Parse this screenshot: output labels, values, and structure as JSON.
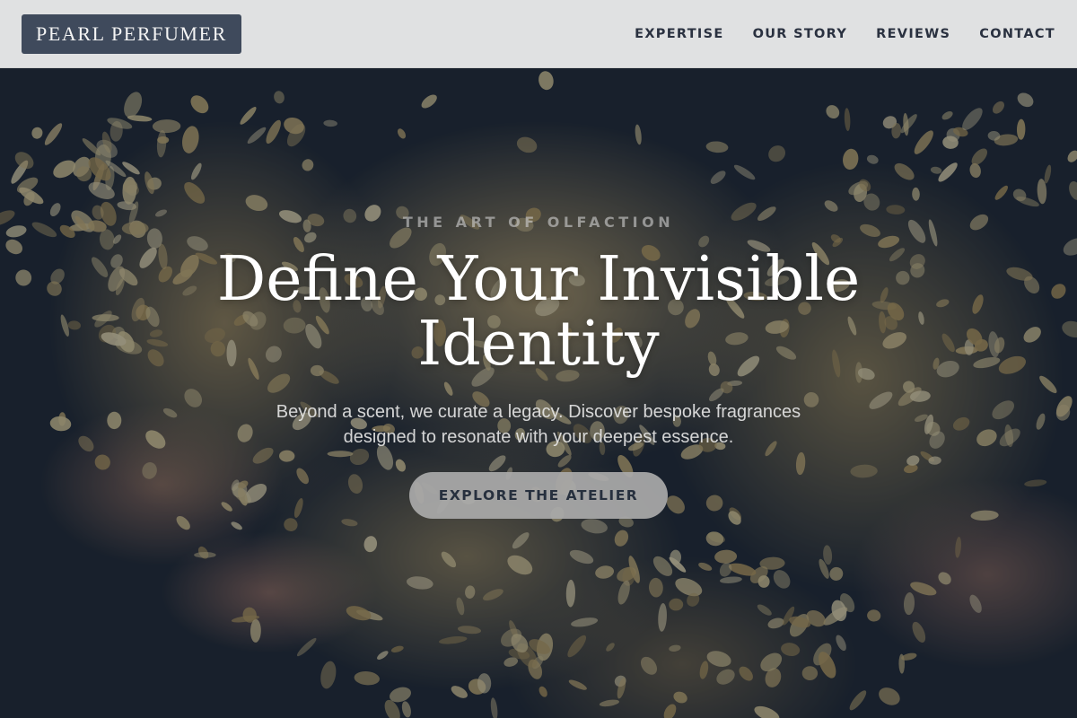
{
  "nav": {
    "brand": "PEARL PERFUMER",
    "links": [
      "EXPERTISE",
      "OUR STORY",
      "REVIEWS",
      "CONTACT"
    ]
  },
  "hero": {
    "eyebrow": "THE ART OF OLFACTION",
    "headline_line1": "Define Your Invisible",
    "headline_line2": "Identity",
    "subtext_line1": "Beyond a scent, we curate a legacy. Discover bespoke fragrances",
    "subtext_line2": "designed to resonate with your deepest essence.",
    "cta_label": "EXPLORE THE ATELIER",
    "image_description": "hands holding a pile of cream-colored flower petals"
  },
  "colors": {
    "brand_bg": "#3f4a5c",
    "nav_bg": "#f0f0f0",
    "nav_text": "#2a3140",
    "overlay": "#161e2a",
    "cta_bg": "#aaaaaa",
    "cta_text": "#27303e",
    "petal": "#d9c48c"
  }
}
